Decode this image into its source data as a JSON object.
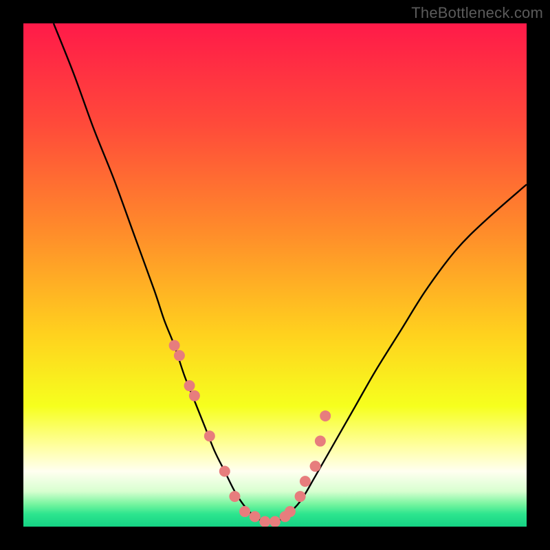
{
  "watermark": "TheBottleneck.com",
  "colors": {
    "frame": "#000000",
    "curve": "#000000",
    "marker_fill": "#e77d7d",
    "marker_stroke": "#c95c5c",
    "gradient_stops": [
      {
        "offset": 0.0,
        "color": "#ff1a49"
      },
      {
        "offset": 0.2,
        "color": "#ff4a3a"
      },
      {
        "offset": 0.42,
        "color": "#ff8e2a"
      },
      {
        "offset": 0.62,
        "color": "#ffd21e"
      },
      {
        "offset": 0.76,
        "color": "#f6ff1e"
      },
      {
        "offset": 0.84,
        "color": "#ffffa0"
      },
      {
        "offset": 0.89,
        "color": "#fffff0"
      },
      {
        "offset": 0.93,
        "color": "#d8ffd0"
      },
      {
        "offset": 0.955,
        "color": "#78f5a0"
      },
      {
        "offset": 0.975,
        "color": "#2de58e"
      },
      {
        "offset": 1.0,
        "color": "#15d284"
      }
    ]
  },
  "chart_data": {
    "type": "line",
    "title": "",
    "xlabel": "",
    "ylabel": "",
    "xlim": [
      0,
      100
    ],
    "ylim": [
      0,
      100
    ],
    "series": [
      {
        "name": "bottleneck-curve",
        "x": [
          6,
          10,
          14,
          18,
          22,
          26,
          28,
          30,
          32,
          34,
          36,
          38,
          40,
          42,
          44,
          46,
          48,
          50,
          52,
          55,
          58,
          62,
          66,
          70,
          75,
          80,
          86,
          92,
          100
        ],
        "y": [
          100,
          90,
          79,
          69,
          58,
          47,
          41,
          36,
          30,
          25,
          20,
          15,
          11,
          7,
          4,
          2,
          1,
          1,
          2,
          5,
          10,
          17,
          24,
          31,
          39,
          47,
          55,
          61,
          68
        ]
      }
    ],
    "markers": {
      "name": "highlight-points",
      "x": [
        30,
        31,
        33,
        34,
        37,
        40,
        42,
        44,
        46,
        48,
        50,
        52,
        53,
        55,
        56,
        58,
        59,
        60
      ],
      "y": [
        36,
        34,
        28,
        26,
        18,
        11,
        6,
        3,
        2,
        1,
        1,
        2,
        3,
        6,
        9,
        12,
        17,
        22
      ]
    }
  }
}
